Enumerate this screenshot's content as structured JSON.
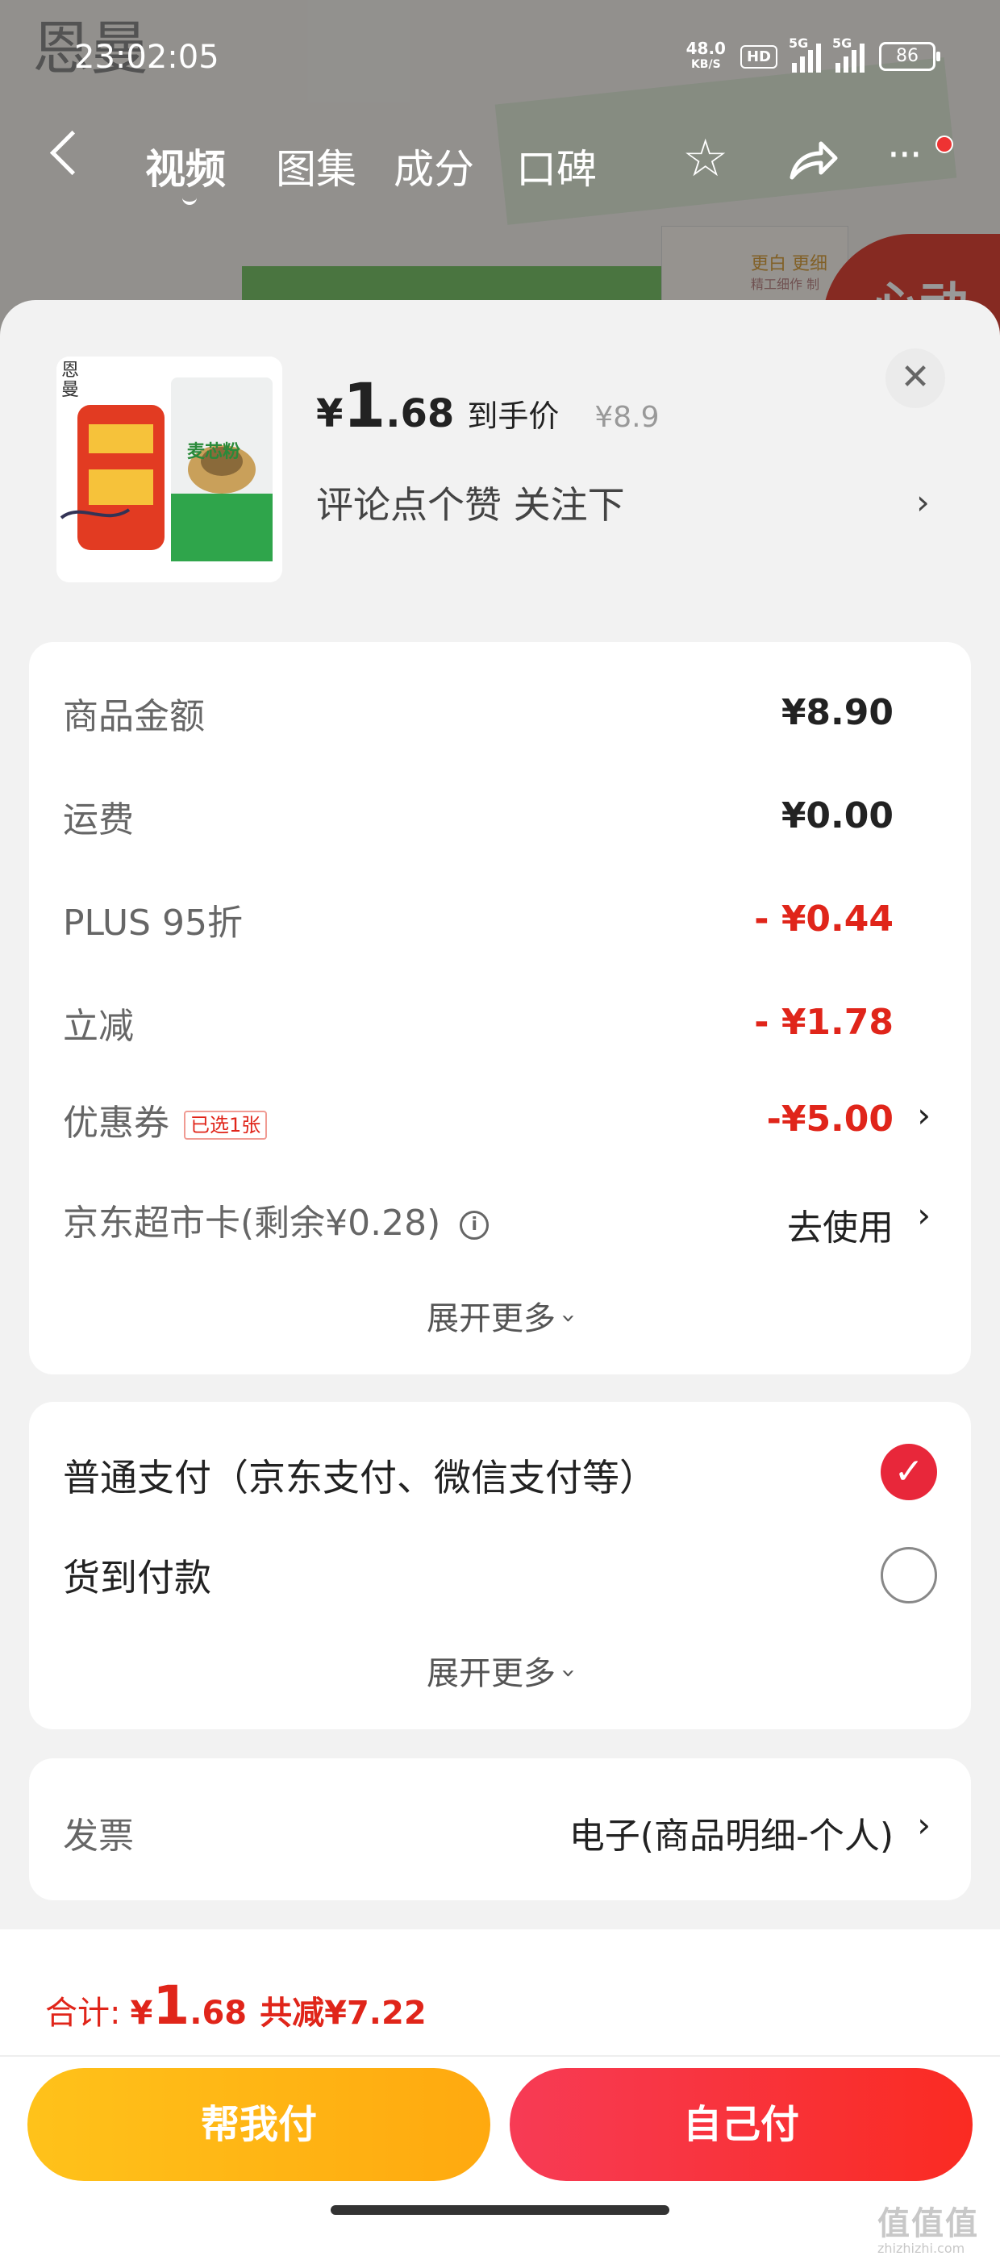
{
  "status_bar": {
    "time": "23:02:05",
    "net_speed_value": "48.0",
    "net_speed_unit": "KB/S",
    "hd": "HD",
    "sig1": "5G",
    "sig2": "5G",
    "battery": "86"
  },
  "nav": {
    "tabs": [
      "视频",
      "图集",
      "成分",
      "口碑"
    ],
    "active_tab": "视频"
  },
  "background_page": {
    "brand": "恩曼",
    "badge": "心动",
    "hint_1": "更白 更细",
    "hint_2": "精工细作 制"
  },
  "product": {
    "brand": "恩曼",
    "pack_name": "麦芯粉",
    "price_symbol": "¥",
    "price_int": "1",
    "price_dec": ".68",
    "price_tag": "到手价",
    "original_price": "¥8.9",
    "comment": "评论点个赞 关注下"
  },
  "summary": {
    "rows": [
      {
        "label": "商品金额",
        "value": "¥8.90"
      },
      {
        "label": "运费",
        "value": "¥0.00"
      },
      {
        "label": "PLUS 95折",
        "value": "- ¥0.44"
      },
      {
        "label": "立减",
        "value": "- ¥1.78"
      },
      {
        "label": "优惠券",
        "badge": "已选1张",
        "value": "-¥5.00"
      },
      {
        "label": "京东超市卡(剩余¥0.28)",
        "info": "i",
        "value": "去使用"
      }
    ],
    "expand": "展开更多"
  },
  "payment": {
    "options": [
      {
        "label": "普通支付（京东支付、微信支付等）",
        "selected": true
      },
      {
        "label": "货到付款",
        "selected": false
      }
    ],
    "expand": "展开更多"
  },
  "invoice": {
    "label": "发票",
    "value": "电子(商品明细-个人)"
  },
  "footer": {
    "total_label": "合计:",
    "total_symbol": "¥",
    "total_int": "1",
    "total_dec": ".68",
    "saved": "共减¥7.22",
    "help_pay": "帮我付",
    "self_pay": "自己付",
    "watermark": "值值值",
    "watermark_url": "zhizhizhi.com"
  },
  "colors": {
    "accent_red": "#e0251a",
    "check_red": "#e8273a",
    "help_btn": "#ffb416",
    "self_btn": "#f8323a"
  }
}
